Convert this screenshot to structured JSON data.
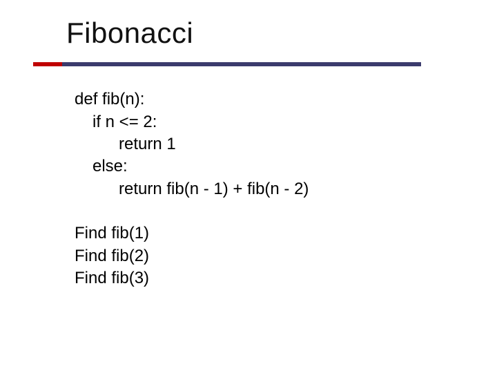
{
  "title": "Fibonacci",
  "code": {
    "l1": "def fib(n):",
    "l2": "if n <= 2:",
    "l3": "return 1",
    "l4": "else:",
    "l5": "return fib(n - 1) + fib(n - 2)"
  },
  "calls": {
    "c1": "Find fib(1)",
    "c2": "Find fib(2)",
    "c3": "Find fib(3)"
  }
}
